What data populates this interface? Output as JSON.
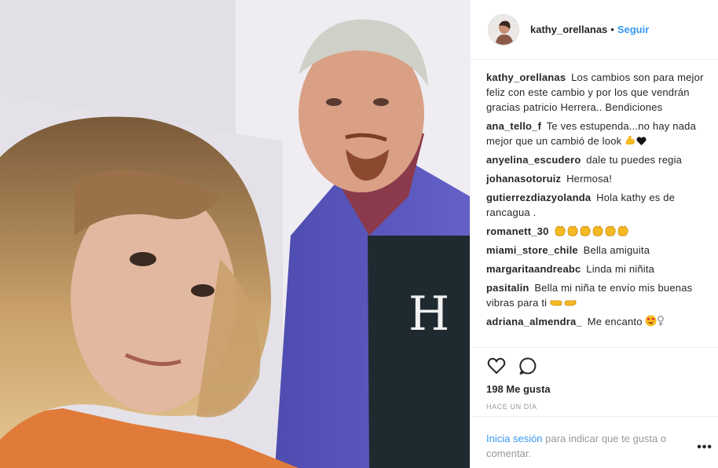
{
  "header": {
    "username": "kathy_orellanas",
    "separator": "•",
    "follow_label": "Seguir"
  },
  "comments": [
    {
      "user": "kathy_orellanas",
      "text": "Los cambios son para mejor feliz con este cambio y por los que vendrán gracias patricio Herrera.. Bendiciones"
    },
    {
      "user": "ana_tello_f",
      "text": "Te ves estupenda...no hay nada mejor que un cambió de look",
      "emoji": [
        "flexed-biceps",
        "black-heart"
      ]
    },
    {
      "user": "anyelina_escudero",
      "text": "dale tu puedes regia"
    },
    {
      "user": "johanasotoruiz",
      "text": "Hermosa!"
    },
    {
      "user": "gutierrezdiazyolanda",
      "text": "Hola kathy es de rancagua ."
    },
    {
      "user": "romanett_30",
      "text": "",
      "emoji": [
        "clapping-hands",
        "clapping-hands",
        "clapping-hands",
        "clapping-hands",
        "clapping-hands",
        "clapping-hands"
      ]
    },
    {
      "user": "miami_store_chile",
      "text": "Bella amiguita"
    },
    {
      "user": "margaritaandreabc",
      "text": "Linda mi niñita"
    },
    {
      "user": "pasitalin",
      "text": "Bella mi niña te envío mis buenas vibras para ti",
      "emoji": [
        "handshake-left",
        "handshake-right"
      ]
    },
    {
      "user": "adriana_almendra_",
      "text": "Me encanto",
      "emoji": [
        "heart-eyes-face",
        "female-sign"
      ]
    }
  ],
  "actions": {
    "like_icon": "heart-outline-icon",
    "comment_icon": "speech-bubble-icon",
    "likes_label": "198 Me gusta",
    "timestamp": "HACE UN DÍA"
  },
  "login": {
    "link_label": "Inicia sesión",
    "rest_text": "para indicar que te gusta o comentar.",
    "more_label": "•••"
  },
  "colors": {
    "link_blue": "#3897f0",
    "text_dark": "#262626",
    "text_gray": "#999999",
    "border": "#efefef"
  }
}
